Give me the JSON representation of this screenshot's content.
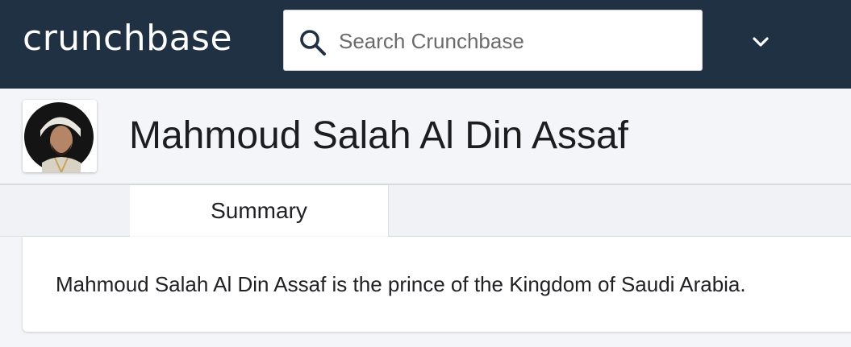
{
  "header": {
    "logo_text": "crunchbase",
    "search": {
      "placeholder": "Search Crunchbase",
      "value": ""
    },
    "menu_icon": "chevron-down-icon"
  },
  "profile": {
    "name": "Mahmoud Salah Al Din Assaf",
    "avatar": "avatar-photo"
  },
  "tabs": [
    {
      "label": "Summary",
      "active": true
    }
  ],
  "summary": {
    "description": "Mahmoud Salah Al Din Assaf is the prince of the Kingdom of Saudi Arabia."
  },
  "colors": {
    "nav_background": "#213144",
    "page_background": "#f4f5f8",
    "card_background": "#ffffff",
    "text": "#1d1d1f"
  }
}
